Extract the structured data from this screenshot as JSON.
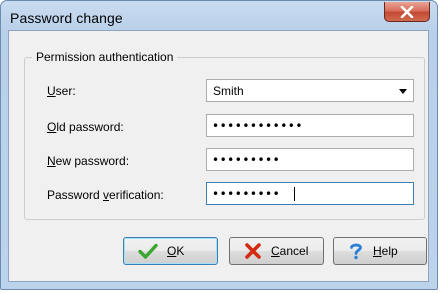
{
  "window": {
    "title": "Password change",
    "close_icon": "close-x-icon"
  },
  "group": {
    "title": "Permission authentication"
  },
  "fields": {
    "user": {
      "label_mnemonic": "U",
      "label_rest": "ser:",
      "value": "Smith"
    },
    "old_password": {
      "label_mnemonic": "O",
      "label_rest": "ld password:",
      "value": "••••••••••••"
    },
    "new_password": {
      "label_mnemonic": "N",
      "label_rest": "ew password:",
      "value": "•••••••••"
    },
    "verification": {
      "label_pre": "Password ",
      "label_mnemonic": "v",
      "label_rest": "erification:",
      "value": "•••••••••"
    }
  },
  "buttons": {
    "ok": {
      "mnemonic": "O",
      "rest": "K",
      "icon": "check-icon",
      "color": "#3aa52f"
    },
    "cancel": {
      "mnemonic": "C",
      "rest": "ancel",
      "icon": "x-icon",
      "color": "#d22b12"
    },
    "help": {
      "mnemonic": "H",
      "rest": "elp",
      "icon": "question-icon",
      "color": "#2a7fd6"
    }
  }
}
